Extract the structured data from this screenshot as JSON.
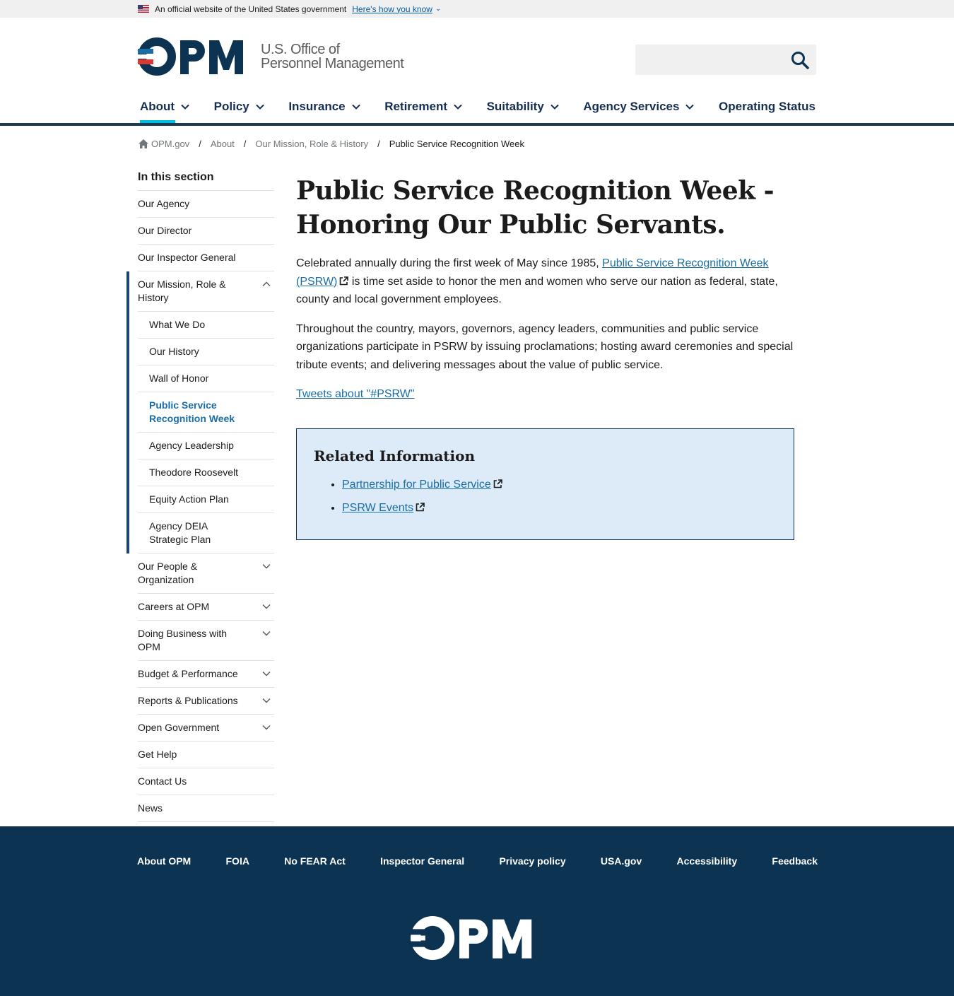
{
  "gov_banner": {
    "text": "An official website of the United States government",
    "link": "Here's how you know"
  },
  "header": {
    "logo_mark": "OPM",
    "logo_line1": "U.S. Office of",
    "logo_line2": "Personnel Management"
  },
  "nav": {
    "items": [
      {
        "label": "About"
      },
      {
        "label": "Policy"
      },
      {
        "label": "Insurance"
      },
      {
        "label": "Retirement"
      },
      {
        "label": "Suitability"
      },
      {
        "label": "Agency Services"
      },
      {
        "label": "Operating Status"
      }
    ]
  },
  "breadcrumb": {
    "home": "OPM.gov",
    "about": "About",
    "mission": "Our Mission, Role & History",
    "current": "Public Service Recognition Week"
  },
  "sidebar": {
    "heading": "In this section",
    "items": [
      "Our Agency",
      "Our Director",
      "Our Inspector General",
      "Our Mission, Role & History",
      "What We Do",
      "Our History",
      "Wall of Honor",
      "Public Service Recognition Week",
      "Agency Leadership",
      "Theodore Roosevelt",
      "Equity Action Plan",
      "Agency DEIA Strategic Plan",
      "Our People & Organization",
      "Careers at OPM",
      "Doing Business with OPM",
      "Budget & Performance",
      "Reports & Publications",
      "Open Government",
      "Get Help",
      "Contact Us",
      "News"
    ]
  },
  "content": {
    "title": "Public Service Recognition Week - Honoring Our Public Servants.",
    "p1_before": "Celebrated annually during the first week of May since 1985, ",
    "p1_link": "Public Service Recognition Week (PSRW)",
    "p1_after": " is time set aside to honor the men and women who serve our nation as federal, state, county and local government employees.",
    "p2": "Throughout the country, mayors, governors, agency leaders, communities and public service organizations participate in PSRW by issuing proclamations; hosting award ceremonies and special tribute events; and delivering messages about the value of public service.",
    "tweets_link": "Tweets about \"#PSRW\"",
    "related_heading": "Related Information",
    "related_links": [
      "Partnership for Public Service",
      "PSRW Events"
    ]
  },
  "footer": {
    "links": [
      "About OPM",
      "FOIA",
      "No FEAR Act",
      "Inspector General",
      "Privacy policy",
      "USA.gov",
      "Accessibility",
      "Feedback"
    ]
  }
}
